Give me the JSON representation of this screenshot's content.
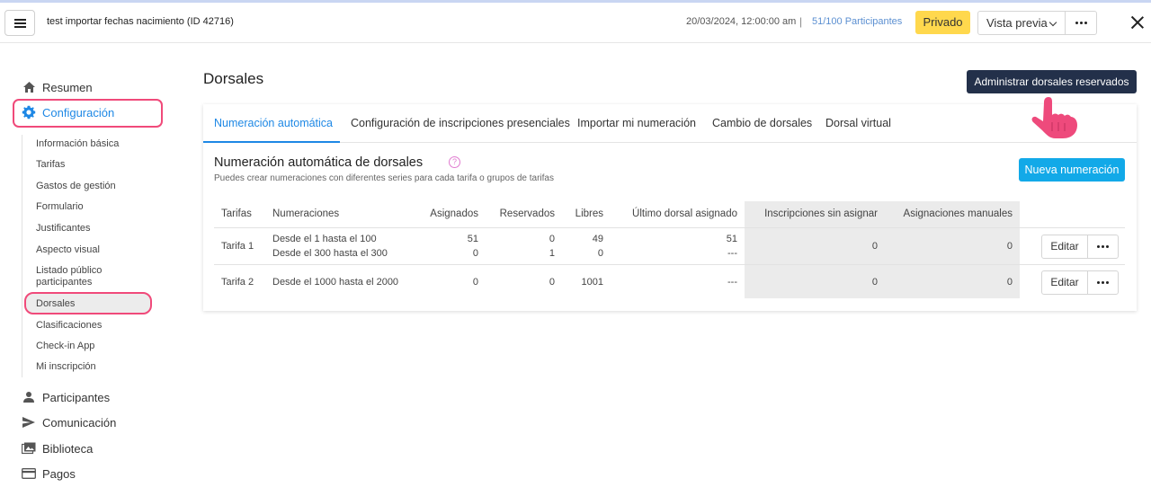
{
  "topbar": {
    "event_title": "test importar fechas nacimiento (ID 42716)",
    "date": "20/03/2024, 12:00:00 am",
    "separator": "|",
    "participants_count": "51/100 Participantes",
    "privacy_label": "Privado",
    "preview_label": "Vista previa"
  },
  "sidebar": {
    "items": [
      {
        "label": "Resumen",
        "icon": "home-icon"
      },
      {
        "label": "Configuración",
        "icon": "gear-icon"
      },
      {
        "label": "Participantes",
        "icon": "person-icon"
      },
      {
        "label": "Comunicación",
        "icon": "send-icon"
      },
      {
        "label": "Biblioteca",
        "icon": "images-icon"
      },
      {
        "label": "Pagos",
        "icon": "card-icon"
      }
    ],
    "config_sub": [
      "Información básica",
      "Tarifas",
      "Gastos de gestión",
      "Formulario",
      "Justificantes",
      "Aspecto visual",
      "Listado público participantes",
      "Dorsales",
      "Clasificaciones",
      "Check-in App",
      "Mi inscripción"
    ]
  },
  "main": {
    "title": "Dorsales",
    "admin_button": "Administrar dorsales reservados",
    "tabs": [
      "Numeración automática",
      "Configuración de inscripciones presenciales",
      "Importar mi numeración",
      "Cambio de dorsales",
      "Dorsal virtual"
    ],
    "section_title": "Numeración automática de dorsales",
    "section_help": "?",
    "section_subtitle": "Puedes crear numeraciones con diferentes series para cada tarifa o grupos de tarifas",
    "new_button": "Nueva numeración",
    "table": {
      "headers": [
        "Tarifas",
        "Numeraciones",
        "Asignados",
        "Reservados",
        "Libres",
        "Último dorsal asignado",
        "Inscripciones sin asignar",
        "Asignaciones manuales"
      ],
      "rows": [
        {
          "tarifa": "Tarifa 1",
          "numeraciones": [
            "Desde el 1 hasta el 100",
            "Desde el 300 hasta el 300"
          ],
          "asignados": [
            "51",
            "0"
          ],
          "reservados": [
            "0",
            "1"
          ],
          "libres": [
            "49",
            "0"
          ],
          "ultimo": [
            "51",
            "---"
          ],
          "sin_asignar": "0",
          "manuales": "0",
          "edit_label": "Editar"
        },
        {
          "tarifa": "Tarifa 2",
          "numeraciones": [
            "Desde el 1000 hasta el 2000"
          ],
          "asignados": [
            "0"
          ],
          "reservados": [
            "0"
          ],
          "libres": [
            "1001"
          ],
          "ultimo": [
            "---"
          ],
          "sin_asignar": "0",
          "manuales": "0",
          "edit_label": "Editar"
        }
      ]
    }
  },
  "colors": {
    "accent": "#1e88e5",
    "highlight": "#f04a7a",
    "privado": "#ffd84d",
    "admin_button": "#23304a",
    "new_button": "#12a9e8"
  }
}
